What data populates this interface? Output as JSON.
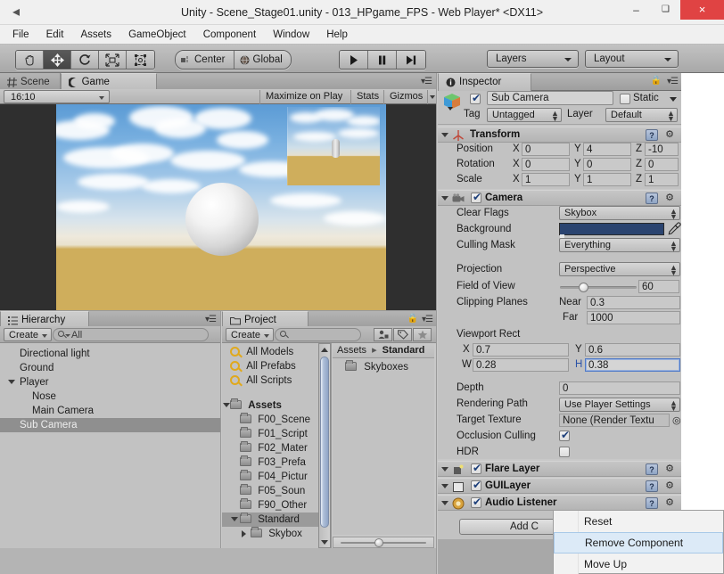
{
  "window": {
    "title": "Unity - Scene_Stage01.unity - 013_HPgame_FPS - Web Player* <DX11>",
    "logo_icon": "unity-logo-icon",
    "minimize": "–",
    "maximize": "❑",
    "close": "×"
  },
  "menubar": {
    "items": [
      "File",
      "Edit",
      "Assets",
      "GameObject",
      "Component",
      "Window",
      "Help"
    ]
  },
  "toolbar": {
    "transform_tools": [
      {
        "name": "hand-tool",
        "glyph": "✋",
        "active": false
      },
      {
        "name": "move-tool",
        "glyph": "✥",
        "active": true
      },
      {
        "name": "rotate-tool",
        "glyph": "↻",
        "active": false
      },
      {
        "name": "scale-tool",
        "glyph": "⤡",
        "active": false
      },
      {
        "name": "rect-tool",
        "glyph": "⧉",
        "active": false
      }
    ],
    "pivot_label": "Center",
    "pivot_rotation_label": "Global",
    "play_buttons": [
      {
        "name": "play-button",
        "glyph": "▶"
      },
      {
        "name": "pause-button",
        "glyph": "❙❙"
      },
      {
        "name": "step-button",
        "glyph": "▶❘"
      }
    ],
    "layers_label": "Layers",
    "layout_label": "Layout"
  },
  "view_tabs": {
    "scene": "Scene",
    "game": "Game",
    "active": "Game"
  },
  "game_view": {
    "aspect": "16:10",
    "maximize_on_play": "Maximize on Play",
    "stats": "Stats",
    "gizmos": "Gizmos"
  },
  "hierarchy": {
    "tab_label": "Hierarchy",
    "create_label": "Create",
    "search_placeholder": "All",
    "items": [
      {
        "label": "Directional light",
        "indent": 0,
        "expandable": false,
        "selected": false
      },
      {
        "label": "Ground",
        "indent": 0,
        "expandable": false,
        "selected": false
      },
      {
        "label": "Player",
        "indent": 0,
        "expandable": true,
        "selected": false
      },
      {
        "label": "Nose",
        "indent": 1,
        "expandable": false,
        "selected": false
      },
      {
        "label": "Main Camera",
        "indent": 1,
        "expandable": false,
        "selected": false
      },
      {
        "label": "Sub Camera",
        "indent": 1,
        "expandable": false,
        "selected": true
      }
    ]
  },
  "project": {
    "tab_label": "Project",
    "create_label": "Create",
    "search_placeholder": "",
    "tree": [
      {
        "label": "All Models",
        "icon": "search-icon",
        "indent": 1,
        "bold": false,
        "selected": false,
        "expandable": false
      },
      {
        "label": "All Prefabs",
        "icon": "search-icon",
        "indent": 1,
        "bold": false,
        "selected": false,
        "expandable": false
      },
      {
        "label": "All Scripts",
        "icon": "search-icon",
        "indent": 1,
        "bold": false,
        "selected": false,
        "expandable": false
      },
      {
        "label": "",
        "icon": "spacer",
        "indent": 0,
        "bold": false,
        "selected": false,
        "expandable": false
      },
      {
        "label": "Assets",
        "icon": "folder-icon",
        "indent": 0,
        "bold": true,
        "selected": false,
        "expandable": true
      },
      {
        "label": "F00_Scene",
        "icon": "folder-icon",
        "indent": 1,
        "bold": false,
        "selected": false,
        "expandable": false
      },
      {
        "label": "F01_Script",
        "icon": "folder-icon",
        "indent": 1,
        "bold": false,
        "selected": false,
        "expandable": false
      },
      {
        "label": "F02_Mater",
        "icon": "folder-icon",
        "indent": 1,
        "bold": false,
        "selected": false,
        "expandable": false
      },
      {
        "label": "F03_Prefa",
        "icon": "folder-icon",
        "indent": 1,
        "bold": false,
        "selected": false,
        "expandable": false
      },
      {
        "label": "F04_Pictur",
        "icon": "folder-icon",
        "indent": 1,
        "bold": false,
        "selected": false,
        "expandable": false
      },
      {
        "label": "F05_Soun",
        "icon": "folder-icon",
        "indent": 1,
        "bold": false,
        "selected": false,
        "expandable": false
      },
      {
        "label": "F90_Other",
        "icon": "folder-icon",
        "indent": 1,
        "bold": false,
        "selected": false,
        "expandable": false
      },
      {
        "label": "Standard",
        "icon": "folder-icon",
        "indent": 1,
        "bold": false,
        "selected": true,
        "expandable": true
      },
      {
        "label": "Skybox",
        "icon": "folder-icon",
        "indent": 2,
        "bold": false,
        "selected": false,
        "expandable": true
      }
    ],
    "breadcrumb_root": "Assets",
    "breadcrumb_sep": "▸",
    "breadcrumb_current": "Standard",
    "contents": [
      {
        "label": "Skyboxes",
        "icon": "folder-icon"
      }
    ]
  },
  "inspector": {
    "tab_label": "Inspector",
    "lock_icon": "lock-icon",
    "menu_icon": "hamburger-icon",
    "object_name": "Sub Camera",
    "object_enabled": true,
    "static_label": "Static",
    "static_checked": false,
    "tag_label": "Tag",
    "tag_value": "Untagged",
    "layer_label": "Layer",
    "layer_value": "Default",
    "components": [
      {
        "name": "Transform",
        "icon": "transform-icon",
        "has_checkbox": false,
        "rows": [
          {
            "label": "Position",
            "fields": [
              {
                "axis": "X",
                "value": "0"
              },
              {
                "axis": "Y",
                "value": "4"
              },
              {
                "axis": "Z",
                "value": "-10"
              }
            ]
          },
          {
            "label": "Rotation",
            "fields": [
              {
                "axis": "X",
                "value": "0"
              },
              {
                "axis": "Y",
                "value": "0"
              },
              {
                "axis": "Z",
                "value": "0"
              }
            ]
          },
          {
            "label": "Scale",
            "fields": [
              {
                "axis": "X",
                "value": "1"
              },
              {
                "axis": "Y",
                "value": "1"
              },
              {
                "axis": "Z",
                "value": "1"
              }
            ]
          }
        ]
      },
      {
        "name": "Camera",
        "icon": "camera-icon",
        "has_checkbox": true,
        "enabled": true
      },
      {
        "name": "Flare Layer",
        "icon": "flare-icon",
        "has_checkbox": true,
        "enabled": true
      },
      {
        "name": "GUILayer",
        "icon": "gui-icon",
        "has_checkbox": true,
        "enabled": true
      },
      {
        "name": "Audio Listener",
        "icon": "audio-icon",
        "has_checkbox": true,
        "enabled": true
      }
    ],
    "camera": {
      "clear_flags_label": "Clear Flags",
      "clear_flags_value": "Skybox",
      "background_label": "Background",
      "background_color": "#2b4470",
      "eyedropper_icon": "eyedropper-icon",
      "culling_mask_label": "Culling Mask",
      "culling_mask_value": "Everything",
      "projection_label": "Projection",
      "projection_value": "Perspective",
      "fov_label": "Field of View",
      "fov_value": "60",
      "clipping_label": "Clipping Planes",
      "near_label": "Near",
      "near_value": "0.3",
      "far_label": "Far",
      "far_value": "1000",
      "viewport_label": "Viewport Rect",
      "viewport_x_axis": "X",
      "viewport_x": "0.7",
      "viewport_y_axis": "Y",
      "viewport_y": "0.6",
      "viewport_w_axis": "W",
      "viewport_w": "0.28",
      "viewport_h_axis": "H",
      "viewport_h": "0.38",
      "depth_label": "Depth",
      "depth_value": "0",
      "rendering_path_label": "Rendering Path",
      "rendering_path_value": "Use Player Settings",
      "target_texture_label": "Target Texture",
      "target_texture_value": "None (Render Textu",
      "target_texture_picker": "◎",
      "occlusion_label": "Occlusion Culling",
      "occlusion_checked": true,
      "hdr_label": "HDR",
      "hdr_checked": false
    },
    "add_component_label": "Add C",
    "help_glyph": "?",
    "gear_glyph": "⚙"
  },
  "context_menu": {
    "items": [
      {
        "label": "Reset",
        "highlighted": false
      },
      {
        "label": "Remove Component",
        "highlighted": true
      },
      {
        "label": "Move Up",
        "highlighted": false
      }
    ]
  }
}
